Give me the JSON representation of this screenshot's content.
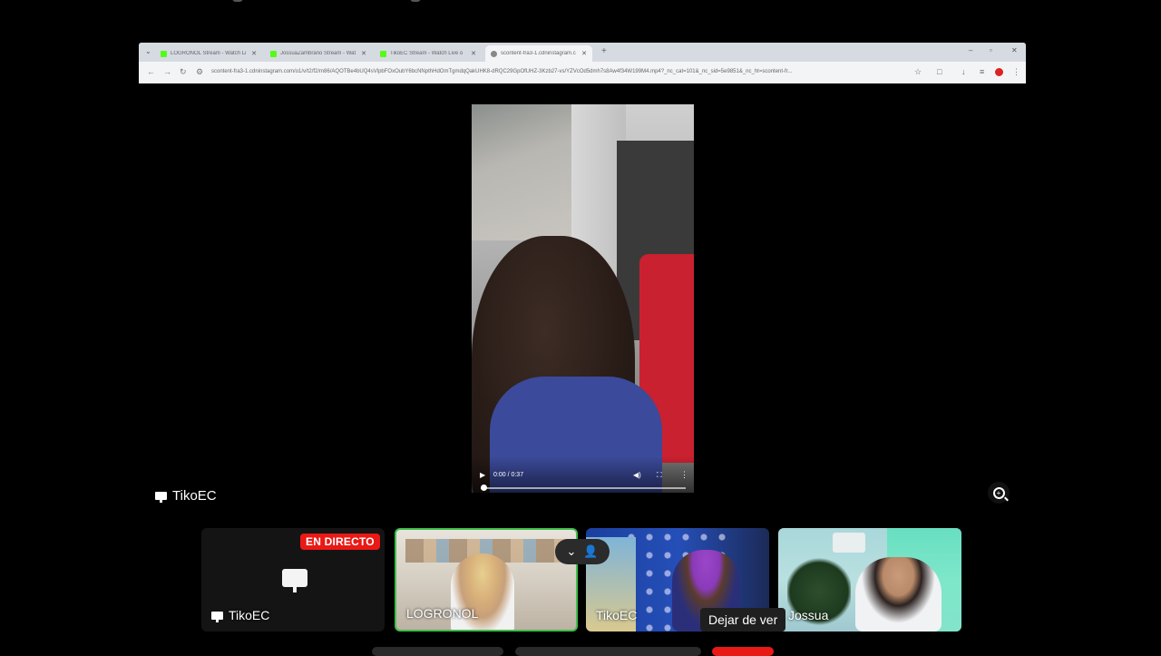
{
  "browser": {
    "tabs": [
      {
        "title": "LOGRONOL Stream - Watch Li"
      },
      {
        "title": "JossuaZambrano Stream - Wat"
      },
      {
        "title": "TikoEC Stream - Watch Live o"
      },
      {
        "title": "scontent-fra3-1.cdninstagram.c"
      }
    ],
    "url": "scontent-fra3-1.cdninstagram.com/o1/v/t2/f2/m86/AQOTBe4bUQ4sVlpbFOxOubY6bcNNpthHdOmTgmdqQakUHK8-dRQC29GpOfUHZ-3Kzb27-vs/YZVcOd5dmh7s8Aw4f34W199M4.mp4?_nc_cat=101&_nc_sid=5e9851&_nc_ht=scontent-fr..."
  },
  "video": {
    "time": "0:00 / 0:37",
    "progress": 0.0
  },
  "main_presenter": {
    "name": "TikoEC"
  },
  "participants": [
    {
      "name": "TikoEC",
      "type": "screen-share"
    },
    {
      "name": "LOGRONOL"
    },
    {
      "name": "TikoEC"
    },
    {
      "name": "Jossua"
    }
  ],
  "live_badge": "EN DIRECTO",
  "tooltip": "Dejar de ver",
  "colors": {
    "live": "#e91916",
    "active_border": "#3fbf4a",
    "kick_green": "#53fc18"
  }
}
